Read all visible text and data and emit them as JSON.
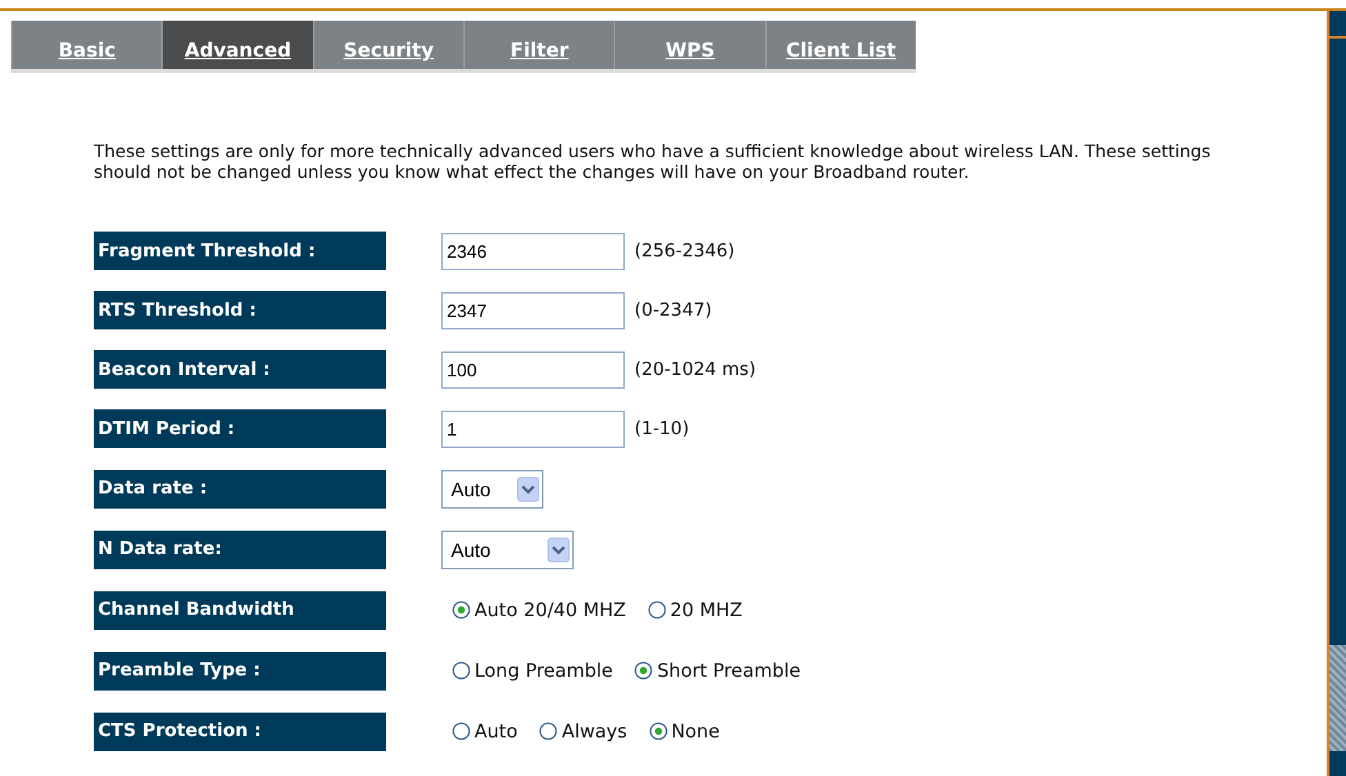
{
  "tabs": [
    {
      "label": "Basic",
      "selected": false
    },
    {
      "label": "Advanced",
      "selected": true
    },
    {
      "label": "Security",
      "selected": false
    },
    {
      "label": "Filter",
      "selected": false
    },
    {
      "label": "WPS",
      "selected": false
    },
    {
      "label": "Client List",
      "selected": false
    }
  ],
  "intro": "These settings are only for more technically advanced users who have a sufficient knowledge about wireless LAN. These settings should not be changed unless you know what effect the changes will have on your Broadband router.",
  "settings": [
    {
      "kind": "text",
      "label": "Fragment Threshold :",
      "value": "2346",
      "range": "(256-2346)"
    },
    {
      "kind": "text",
      "label": "RTS Threshold :",
      "value": "2347",
      "range": "(0-2347)"
    },
    {
      "kind": "text",
      "label": "Beacon Interval :",
      "value": "100",
      "range": "(20-1024 ms)"
    },
    {
      "kind": "text",
      "label": "DTIM Period :",
      "value": "1",
      "range": "(1-10)"
    },
    {
      "kind": "select",
      "label": "Data rate :",
      "value": "Auto"
    },
    {
      "kind": "select",
      "label": "N Data rate:",
      "value": "Auto",
      "wide": true
    },
    {
      "kind": "radio",
      "label": "Channel Bandwidth",
      "options": [
        {
          "label": "Auto 20/40 MHZ",
          "selected": true
        },
        {
          "label": "20 MHZ",
          "selected": false
        }
      ]
    },
    {
      "kind": "radio",
      "label": "Preamble Type :",
      "options": [
        {
          "label": "Long Preamble",
          "selected": false
        },
        {
          "label": "Short Preamble",
          "selected": true
        }
      ]
    },
    {
      "kind": "radio",
      "label": "CTS Protection :",
      "options": [
        {
          "label": "Auto",
          "selected": false
        },
        {
          "label": "Always",
          "selected": false
        },
        {
          "label": "None",
          "selected": true
        }
      ]
    }
  ]
}
